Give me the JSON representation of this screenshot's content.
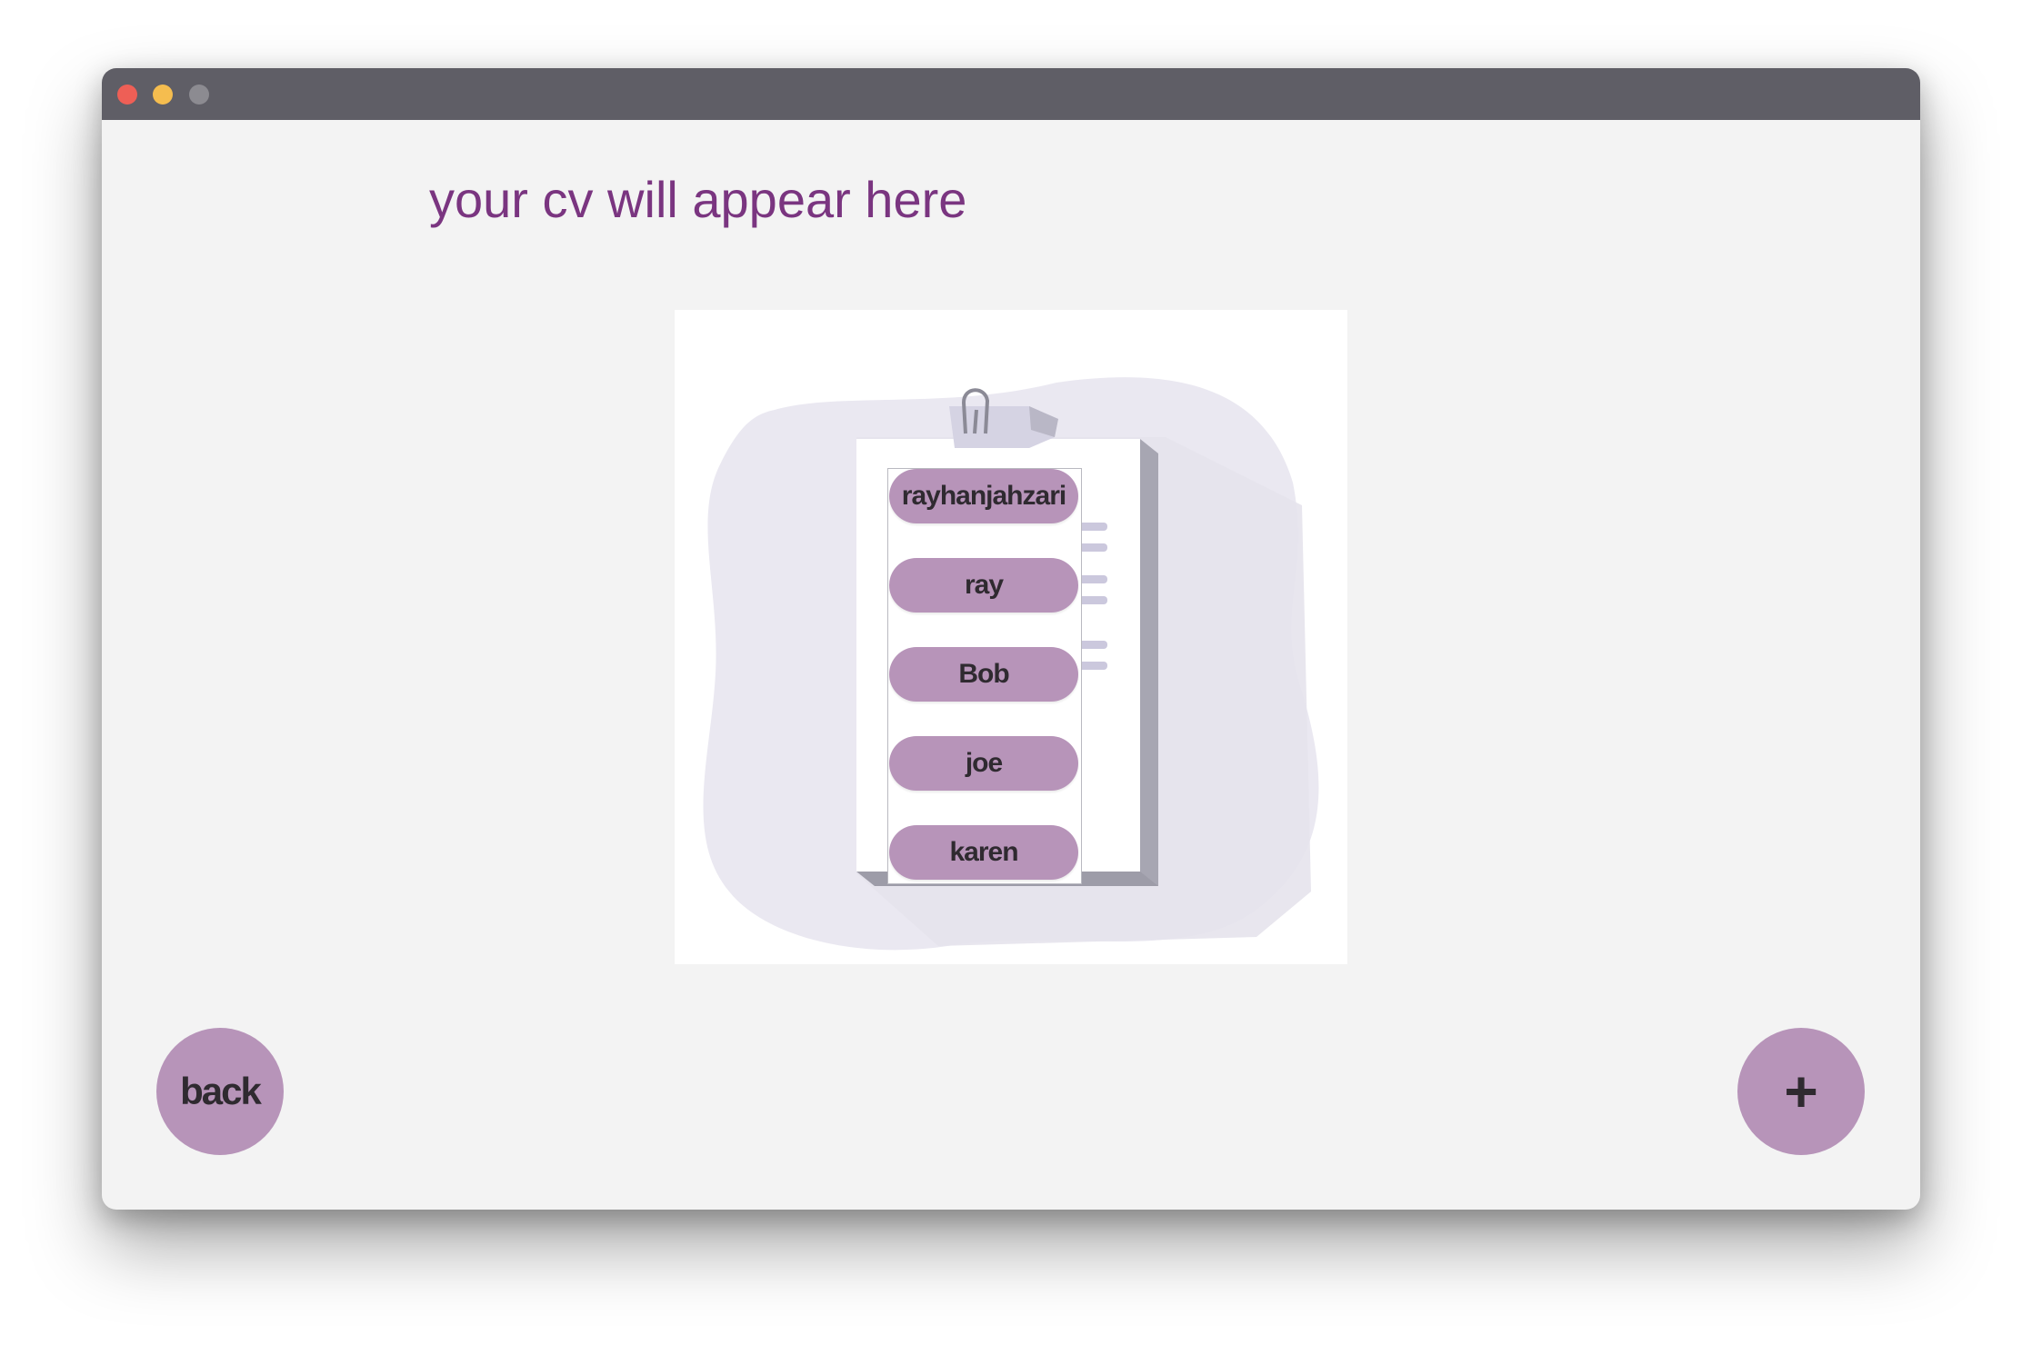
{
  "window": {
    "traffic_lights": [
      "close",
      "minimize",
      "zoom"
    ]
  },
  "page": {
    "heading": "your cv will appear here"
  },
  "cv_list": {
    "names": [
      "rayhanjahzari",
      "ray",
      "Bob",
      "joe",
      "karen"
    ]
  },
  "buttons": {
    "back_label": "back",
    "add_label": "+"
  },
  "colors": {
    "accent": "#b794b9",
    "heading": "#7a3580",
    "titlebar": "#5f5e66",
    "window_bg": "#f3f3f3",
    "blob": "#eae8f1"
  }
}
